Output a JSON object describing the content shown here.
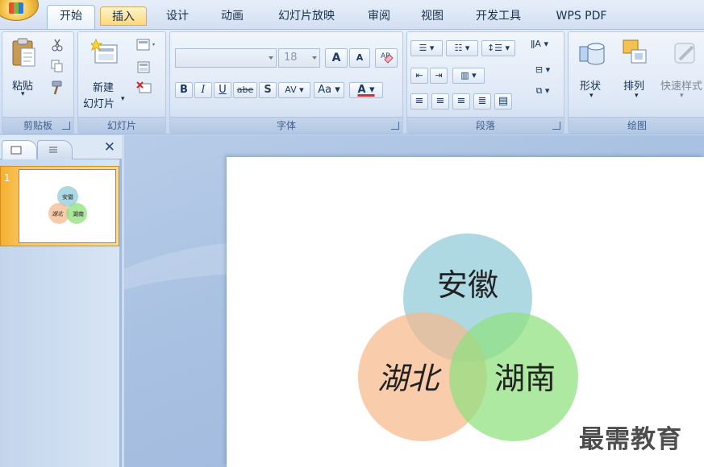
{
  "tabs": [
    {
      "label": "开始"
    },
    {
      "label": "插入"
    },
    {
      "label": "设计"
    },
    {
      "label": "动画"
    },
    {
      "label": "幻灯片放映"
    },
    {
      "label": "审阅"
    },
    {
      "label": "视图"
    },
    {
      "label": "开发工具"
    },
    {
      "label": "WPS PDF"
    }
  ],
  "ribbon": {
    "clipboard": {
      "paste_label": "粘贴",
      "group_label": "剪贴板"
    },
    "slides": {
      "new_slide_line1": "新建",
      "new_slide_line2": "幻灯片",
      "group_label": "幻灯片"
    },
    "font": {
      "font_name": "",
      "font_size": "18",
      "group_label": "字体",
      "bold": "B",
      "italic": "I",
      "underline": "U",
      "strike": "abe",
      "shadow": "S",
      "spacing": "AV",
      "case": "Aa",
      "color": "A",
      "grow": "A",
      "shrink": "A"
    },
    "paragraph": {
      "group_label": "段落"
    },
    "drawing": {
      "shapes_label": "形状",
      "arrange_label": "排列",
      "quick_styles_label": "快速样式",
      "group_label": "绘图"
    }
  },
  "left_panel": {
    "slide_number": "1",
    "close": "✕"
  },
  "slide": {
    "circles": [
      {
        "label": "安徽",
        "color": "#8fcbd8"
      },
      {
        "label": "湖北",
        "color": "#f7b98c"
      },
      {
        "label": "湖南",
        "color": "#8fe07e"
      }
    ]
  },
  "watermark": "最需教育",
  "colors": {
    "ribbon_bg": "#d6e3f4",
    "accent_tab": "#ffd87c",
    "selection": "#f5b02e"
  }
}
